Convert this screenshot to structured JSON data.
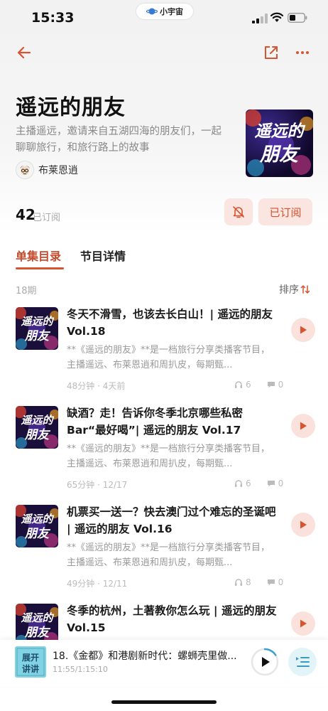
{
  "status_bar": {
    "time": "15:33",
    "app_pill": "小宇宙"
  },
  "podcast": {
    "title": "遥远的朋友",
    "description": "主播遥远，邀请来自五湖四海的朋友们，一起聊聊旅行，和旅行路上的故事",
    "host": "布莱恩逍",
    "cover_text": [
      "遥远的",
      "朋友"
    ]
  },
  "subscription": {
    "count": "42",
    "count_label": "已订阅",
    "subscribed_label": "已订阅"
  },
  "tabs": [
    {
      "label": "单集目录"
    },
    {
      "label": "节目详情"
    }
  ],
  "episode_list": {
    "count_label": "18期",
    "sort_label": "排序",
    "episodes": [
      {
        "title": "冬天不滑雪，也该去长白山！| 遥远的朋友 Vol.18",
        "desc": "**《遥远的朋友》**是一档旅行分享类播客节目，主播遥远、布莱恩逍和周扒皮，每期甄...",
        "meta": "48分钟 · 4天前",
        "plays": "6",
        "comments": "0"
      },
      {
        "title": "缺酒？走！告诉你冬季北京哪些私密Bar“最好喝”| 遥远的朋友 Vol.17",
        "desc": "**《遥远的朋友》**是一档旅行分享类播客节目，主播遥远、布莱恩逍和周扒皮，每期甄...",
        "meta": "65分钟 · 12/17",
        "plays": "6",
        "comments": "0"
      },
      {
        "title": "机票买一送一？快去澳门过个难忘的圣诞吧 | 遥远的朋友 Vol.16",
        "desc": "**《遥远的朋友》**是一档旅行分享类播客节目，主播遥远、布莱恩逍和周扒皮，每期甄...",
        "meta": "49分钟 · 12/11",
        "plays": "8",
        "comments": "0"
      },
      {
        "title": "冬季的杭州，土著教你怎么玩 | 遥远的朋友 Vol.15",
        "desc": "",
        "meta": "",
        "plays": "",
        "comments": ""
      }
    ]
  },
  "player": {
    "title": "18.《金都》和港剧新时代：螺蛳壳里做...",
    "time": "11:55/1:15:10",
    "cover_text": [
      "展开",
      "讲讲"
    ],
    "progress_fraction": 0.16
  },
  "colors": {
    "accent": "#d6542f",
    "accent_bg": "#fbe5e0",
    "player_accent": "#3aa0d0"
  }
}
